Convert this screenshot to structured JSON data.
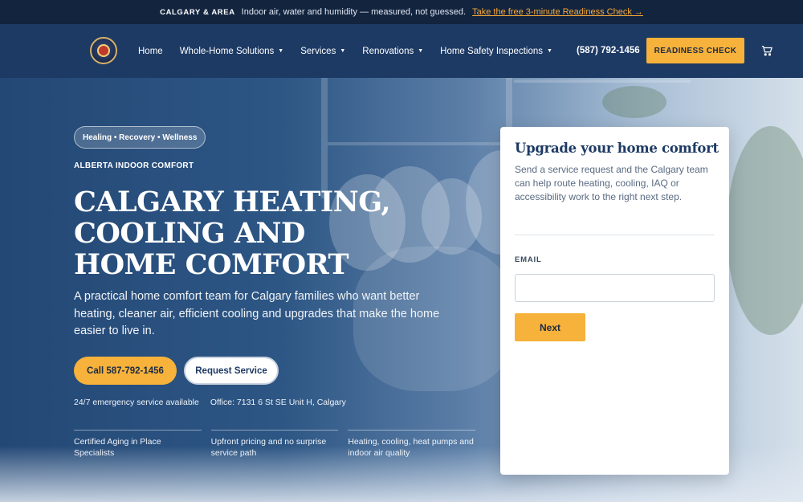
{
  "topbar": {
    "area": "CALGARY & AREA",
    "message": "Indoor air, water and humidity — measured, not guessed.",
    "link": "Take the free 3-minute Readiness Check →"
  },
  "nav": {
    "logo_icon": "company-seal-logo",
    "items": [
      {
        "label": "Home",
        "has_dropdown": false
      },
      {
        "label": "Whole-Home Solutions",
        "has_dropdown": true
      },
      {
        "label": "Services",
        "has_dropdown": true
      },
      {
        "label": "Renovations",
        "has_dropdown": true
      },
      {
        "label": "Home Safety Inspections",
        "has_dropdown": true
      }
    ],
    "phone": "(587) 792-1456",
    "cta": "READINESS CHECK",
    "cart_icon": "cart-icon"
  },
  "hero": {
    "pill": "Healing • Recovery • Wellness",
    "eyebrow": "ALBERTA INDOOR COMFORT",
    "headline_lines": [
      "CALGARY HEATING,",
      "COOLING AND",
      "HOME COMFORT"
    ],
    "lead": "A practical home comfort team for Calgary families who want better heating, cleaner air, efficient cooling and upgrades that make the home easier to live in.",
    "call_button": "Call 587-792-1456",
    "request_button": "Request Service",
    "meta": [
      "24/7 emergency service available",
      "Office: 7131 6 St SE Unit H, Calgary"
    ],
    "features": [
      "Certified Aging in Place Specialists",
      "Upfront pricing and no surprise service path",
      "Heating, cooling, heat pumps and indoor air quality"
    ]
  },
  "form": {
    "title": "Upgrade your home comfort",
    "description": "Send a service request and the Calgary team can help route heating, cooling, IAQ or accessibility work to the right next step.",
    "email_label": "EMAIL",
    "email_value": "",
    "next_button": "Next"
  },
  "colors": {
    "accent": "#f6b23a",
    "nav_bg": "#1d3a64",
    "topbar_bg": "#13243f",
    "link": "#f6a93b"
  }
}
